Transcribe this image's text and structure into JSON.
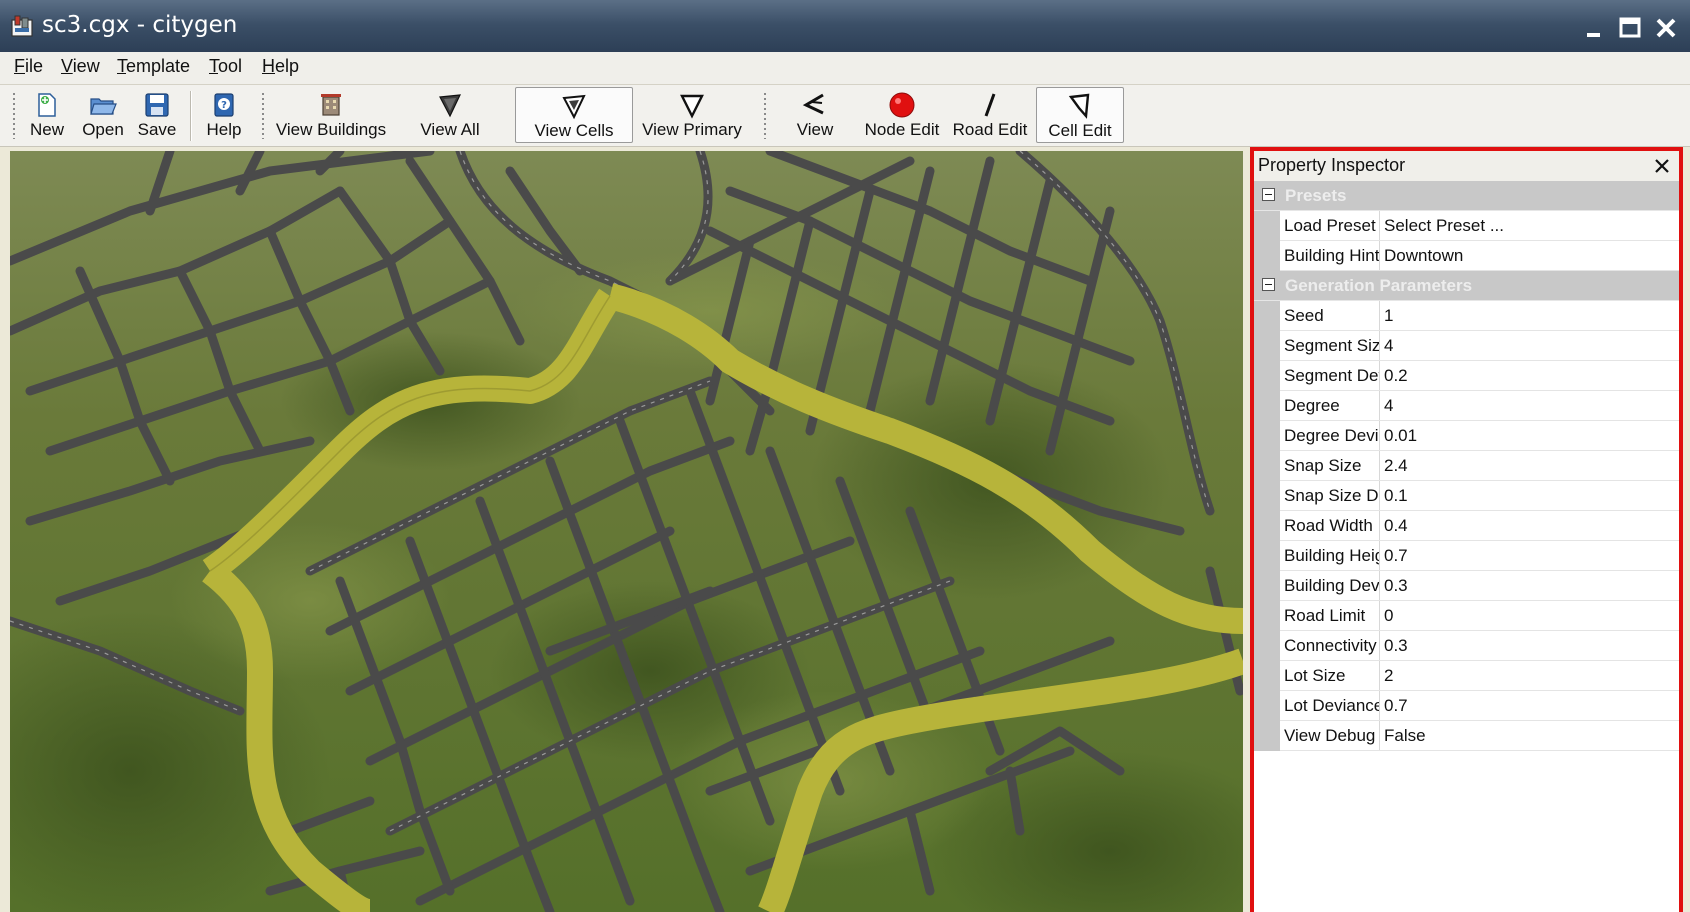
{
  "window": {
    "title": "sc3.cgx - citygen"
  },
  "menu": [
    "File",
    "View",
    "Template",
    "Tool",
    "Help"
  ],
  "toolbar": {
    "new": "New",
    "open": "Open",
    "save": "Save",
    "help": "Help",
    "view_buildings": "View Buildings",
    "view_all": "View All",
    "view_cells": "View Cells",
    "view_primary": "View Primary",
    "view": "View",
    "node_edit": "Node Edit",
    "road_edit": "Road Edit",
    "cell_edit": "Cell Edit",
    "active_tools": [
      "View Cells",
      "Cell Edit"
    ]
  },
  "inspector": {
    "title": "Property Inspector",
    "categories": [
      {
        "label": "Presets",
        "rows": [
          {
            "name": "Load Preset",
            "value": "Select Preset ..."
          },
          {
            "name": "Building Hint",
            "value": "Downtown"
          }
        ]
      },
      {
        "label": "Generation Parameters",
        "rows": [
          {
            "name": "Seed",
            "value": "1"
          },
          {
            "name": "Segment Size",
            "value": "4"
          },
          {
            "name": "Segment Deviance",
            "value": "0.2"
          },
          {
            "name": "Degree",
            "value": "4"
          },
          {
            "name": "Degree Deviance",
            "value": "0.01"
          },
          {
            "name": "Snap Size",
            "value": "2.4"
          },
          {
            "name": "Snap Size Deviance",
            "value": "0.1"
          },
          {
            "name": "Road Width",
            "value": "0.4"
          },
          {
            "name": "Building Height",
            "value": "0.7"
          },
          {
            "name": "Building Deviance",
            "value": "0.3"
          },
          {
            "name": "Road Limit",
            "value": "0"
          },
          {
            "name": "Connectivity",
            "value": "0.3"
          },
          {
            "name": "Lot Size",
            "value": "2"
          },
          {
            "name": "Lot Deviance",
            "value": "0.7"
          },
          {
            "name": "View Debug",
            "value": "False"
          }
        ]
      }
    ]
  },
  "colors": {
    "highlight_border": "#e01010",
    "primary_road": "#b7b43a",
    "secondary_road": "#4a4a4a",
    "terrain": "#5c7430"
  }
}
